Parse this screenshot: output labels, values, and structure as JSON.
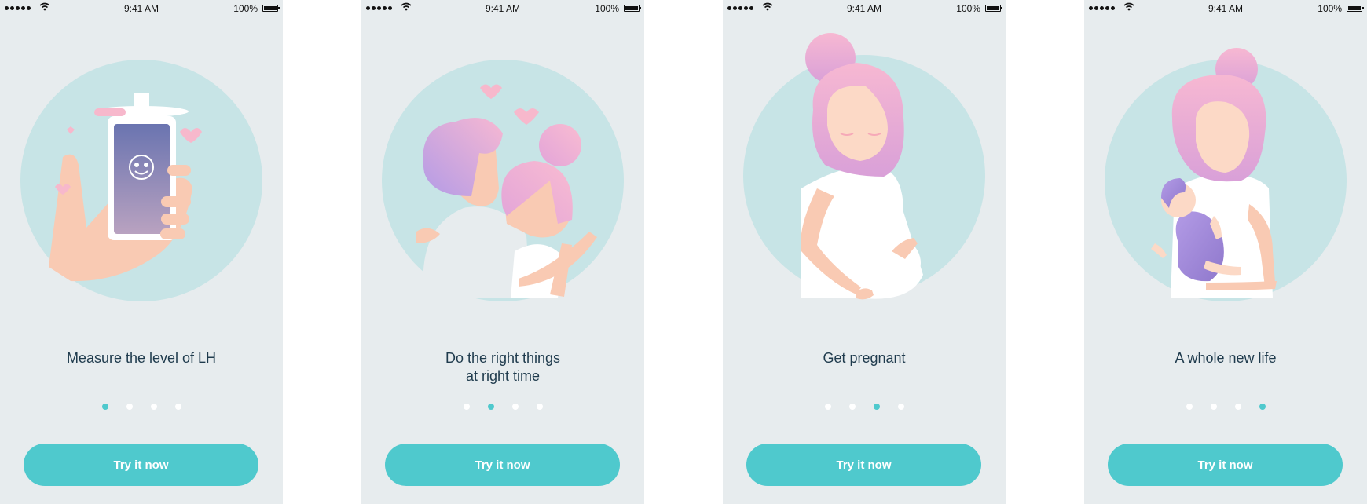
{
  "status_bar": {
    "time": "9:41 AM",
    "battery": "100%"
  },
  "colors": {
    "accent": "#4fc9cd",
    "background": "#e7ecee",
    "circle": "#c7e4e6",
    "text": "#1f3b4d"
  },
  "screens": [
    {
      "caption": "Measure the level of LH",
      "button_label": "Try it now",
      "active_page": 1,
      "page_count": 4,
      "illustration": "hand-holding-phone-illustration"
    },
    {
      "caption": "Do the right things\nat right time",
      "button_label": "Try it now",
      "active_page": 2,
      "page_count": 4,
      "illustration": "couple-hugging-illustration"
    },
    {
      "caption": "Get pregnant",
      "button_label": "Try it now",
      "active_page": 3,
      "page_count": 4,
      "illustration": "pregnant-woman-illustration"
    },
    {
      "caption": "A whole new life",
      "button_label": "Try it now",
      "active_page": 4,
      "page_count": 4,
      "illustration": "mother-with-baby-illustration"
    }
  ]
}
